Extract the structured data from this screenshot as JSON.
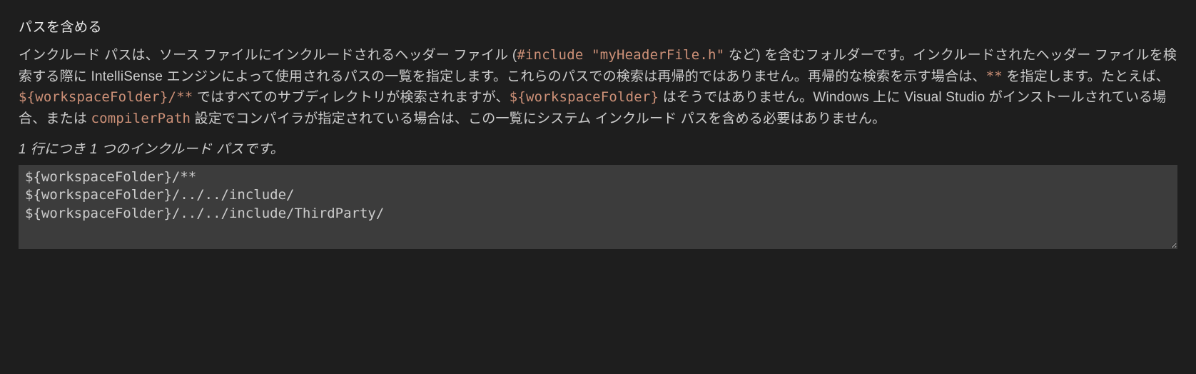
{
  "section": {
    "title": "パスを含める",
    "desc_parts": {
      "t1": "インクルード パスは、ソース ファイルにインクルードされるヘッダー ファイル (",
      "code1": "#include \"myHeaderFile.h\"",
      "t2": " など) を含むフォルダーです。インクルードされたヘッダー ファイルを検索する際に IntelliSense エンジンによって使用されるパスの一覧を指定します。これらのパスでの検索は再帰的ではありません。再帰的な検索を示す場合は、",
      "code2": "**",
      "t3": " を指定します。たとえば、",
      "code3": "${workspaceFolder}/**",
      "t4": " ではすべてのサブディレクトリが検索されますが、",
      "code4": "${workspaceFolder}",
      "t5": " はそうではありません。Windows 上に Visual Studio がインストールされている場合、または ",
      "code5": "compilerPath",
      "t6": " 設定でコンパイラが指定されている場合は、この一覧にシステム インクルード パスを含める必要はありません。"
    },
    "hint": "1 行につき 1 つのインクルード パスです。",
    "input_value": "${workspaceFolder}/**\n${workspaceFolder}/../../include/\n${workspaceFolder}/../../include/ThirdParty/"
  }
}
